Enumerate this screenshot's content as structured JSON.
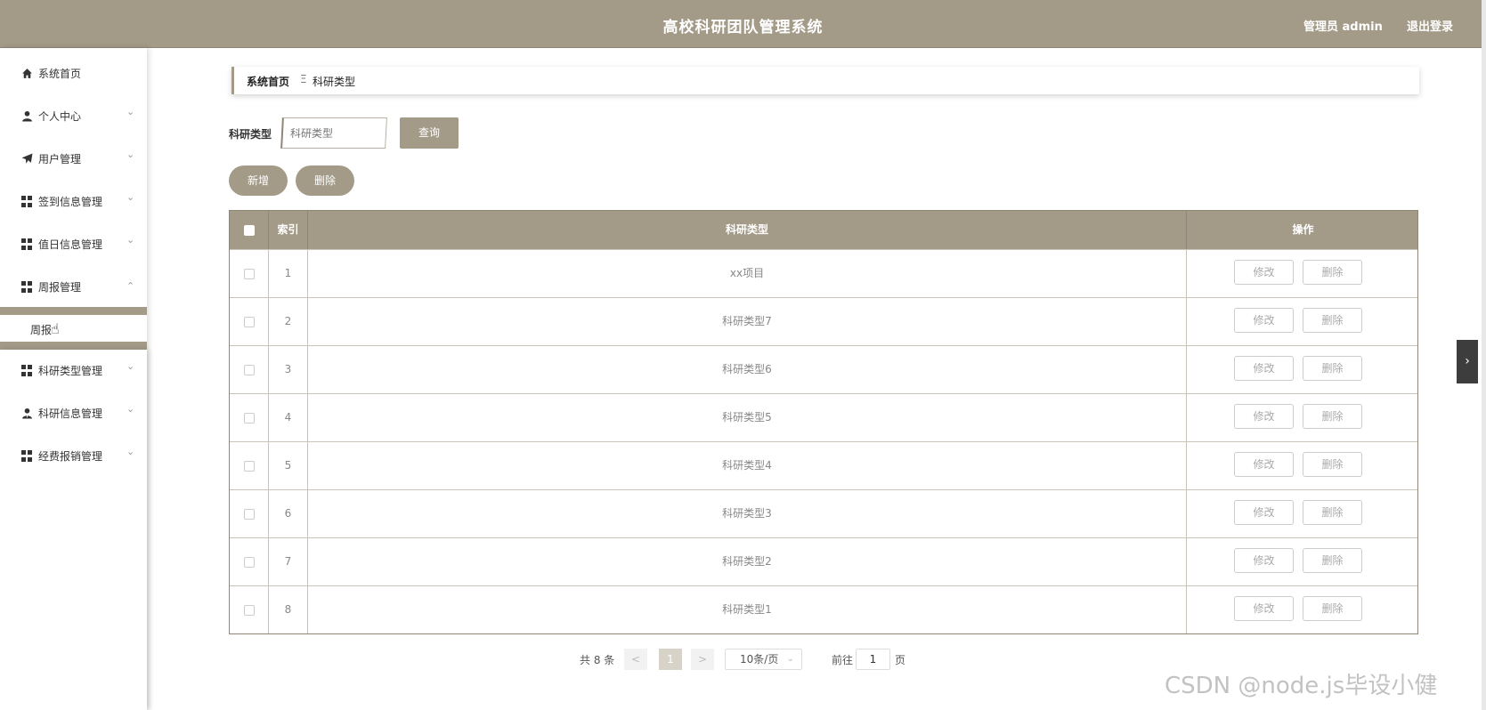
{
  "header": {
    "title": "高校科研团队管理系统",
    "user": "管理员 admin",
    "logout": "退出登录"
  },
  "sidebar": {
    "items": [
      {
        "label": "系统首页",
        "icon": "home-icon",
        "expandable": false
      },
      {
        "label": "个人中心",
        "icon": "user-icon",
        "expandable": true
      },
      {
        "label": "用户管理",
        "icon": "paper-plane-icon",
        "expandable": true
      },
      {
        "label": "签到信息管理",
        "icon": "grid-icon",
        "expandable": true
      },
      {
        "label": "值日信息管理",
        "icon": "grid-icon",
        "expandable": true
      },
      {
        "label": "周报管理",
        "icon": "grid-icon",
        "expandable": true,
        "expanded": true
      },
      {
        "label": "科研类型管理",
        "icon": "grid-icon",
        "expandable": true
      },
      {
        "label": "科研信息管理",
        "icon": "user-tie-icon",
        "expandable": true
      },
      {
        "label": "经费报销管理",
        "icon": "grid-icon",
        "expandable": true
      }
    ],
    "sub_item": "周报",
    "arrow_down": "⌄",
    "arrow_up": "⌃"
  },
  "breadcrumb": {
    "home": "系统首页",
    "separator": "Ξ",
    "current": "科研类型"
  },
  "search": {
    "label": "科研类型",
    "placeholder": "科研类型",
    "button": "查询"
  },
  "actions": {
    "add": "新增",
    "delete": "删除"
  },
  "table": {
    "columns": [
      "索引",
      "科研类型",
      "操作"
    ],
    "rows": [
      {
        "index": "1",
        "type": "xx项目"
      },
      {
        "index": "2",
        "type": "科研类型7"
      },
      {
        "index": "3",
        "type": "科研类型6"
      },
      {
        "index": "4",
        "type": "科研类型5"
      },
      {
        "index": "5",
        "type": "科研类型4"
      },
      {
        "index": "6",
        "type": "科研类型3"
      },
      {
        "index": "7",
        "type": "科研类型2"
      },
      {
        "index": "8",
        "type": "科研类型1"
      }
    ],
    "edit_label": "修改",
    "remove_label": "删除"
  },
  "pagination": {
    "total": "共 8 条",
    "prev": "<",
    "current_page": "1",
    "next": ">",
    "page_size": "10条/页",
    "goto_label": "前往",
    "goto_value": "1",
    "page_suffix": "页"
  },
  "side_toggle": "›",
  "watermark": "CSDN @node.js毕设小健",
  "colors": {
    "accent": "#a39a88",
    "accent_dark": "#8e8676"
  }
}
